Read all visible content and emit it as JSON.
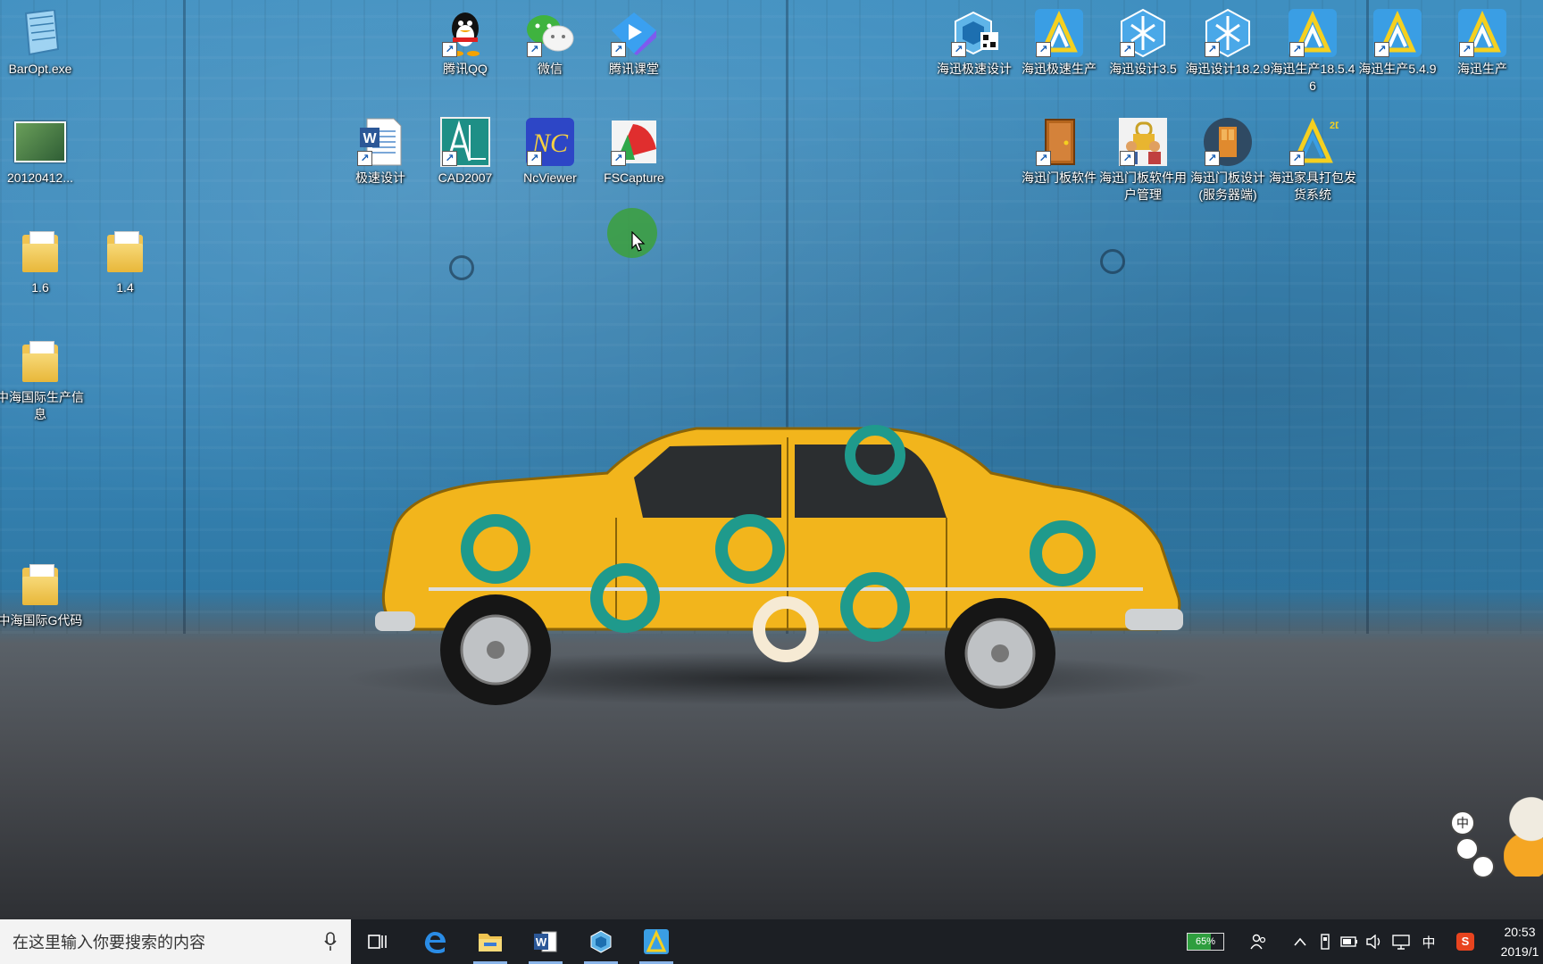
{
  "desktop": {
    "icons": [
      {
        "label": "BarOpt.exe",
        "icon": "notepad-icon"
      },
      {
        "label": "20120412...",
        "icon": "image-file-icon"
      },
      {
        "label": "1.6",
        "icon": "folder-icon"
      },
      {
        "label": "1.4",
        "icon": "folder-icon"
      },
      {
        "label": "中海国际生产信息",
        "icon": "folder-icon"
      },
      {
        "label": "中海国际G代码",
        "icon": "folder-icon"
      },
      {
        "label": "腾讯QQ",
        "icon": "qq-penguin-icon"
      },
      {
        "label": "微信",
        "icon": "wechat-icon"
      },
      {
        "label": "腾讯课堂",
        "icon": "tencent-classroom-icon"
      },
      {
        "label": "极速设计",
        "icon": "word-doc-icon"
      },
      {
        "label": "CAD2007",
        "icon": "cad-icon"
      },
      {
        "label": "NcViewer",
        "icon": "ncviewer-icon"
      },
      {
        "label": "FSCapture",
        "icon": "fscapture-icon"
      },
      {
        "label": "海迅极速设计",
        "icon": "haixun-cube-icon"
      },
      {
        "label": "海迅极速生产",
        "icon": "haixun-triangle-icon"
      },
      {
        "label": "海迅设计3.5",
        "icon": "haixun-hex-icon"
      },
      {
        "label": "海迅设计18.2.9",
        "icon": "haixun-hex-icon"
      },
      {
        "label": "海迅生产18.5.46",
        "icon": "haixun-triangle-icon"
      },
      {
        "label": "海迅生产5.4.9",
        "icon": "haixun-triangle-icon"
      },
      {
        "label": "海迅生产",
        "icon": "haixun-triangle-icon"
      },
      {
        "label": "海迅门板软件",
        "icon": "door-icon"
      },
      {
        "label": "海迅门板软件用户管理",
        "icon": "users-lock-icon"
      },
      {
        "label": "海迅门板设计(服务器端)",
        "icon": "door-server-icon"
      },
      {
        "label": "海迅家具打包发货系统",
        "icon": "haixun-2d-icon"
      }
    ]
  },
  "taskbar": {
    "search_placeholder": "在这里输入你要搜索的内容",
    "battery_percent": "65%",
    "ime_label": "中",
    "time": "20:53",
    "date": "2019/1",
    "colors": {
      "taskbar_bg": "#1c1f24",
      "accent": "#8ab4e8"
    }
  },
  "floating": {
    "ime_label": "中"
  }
}
